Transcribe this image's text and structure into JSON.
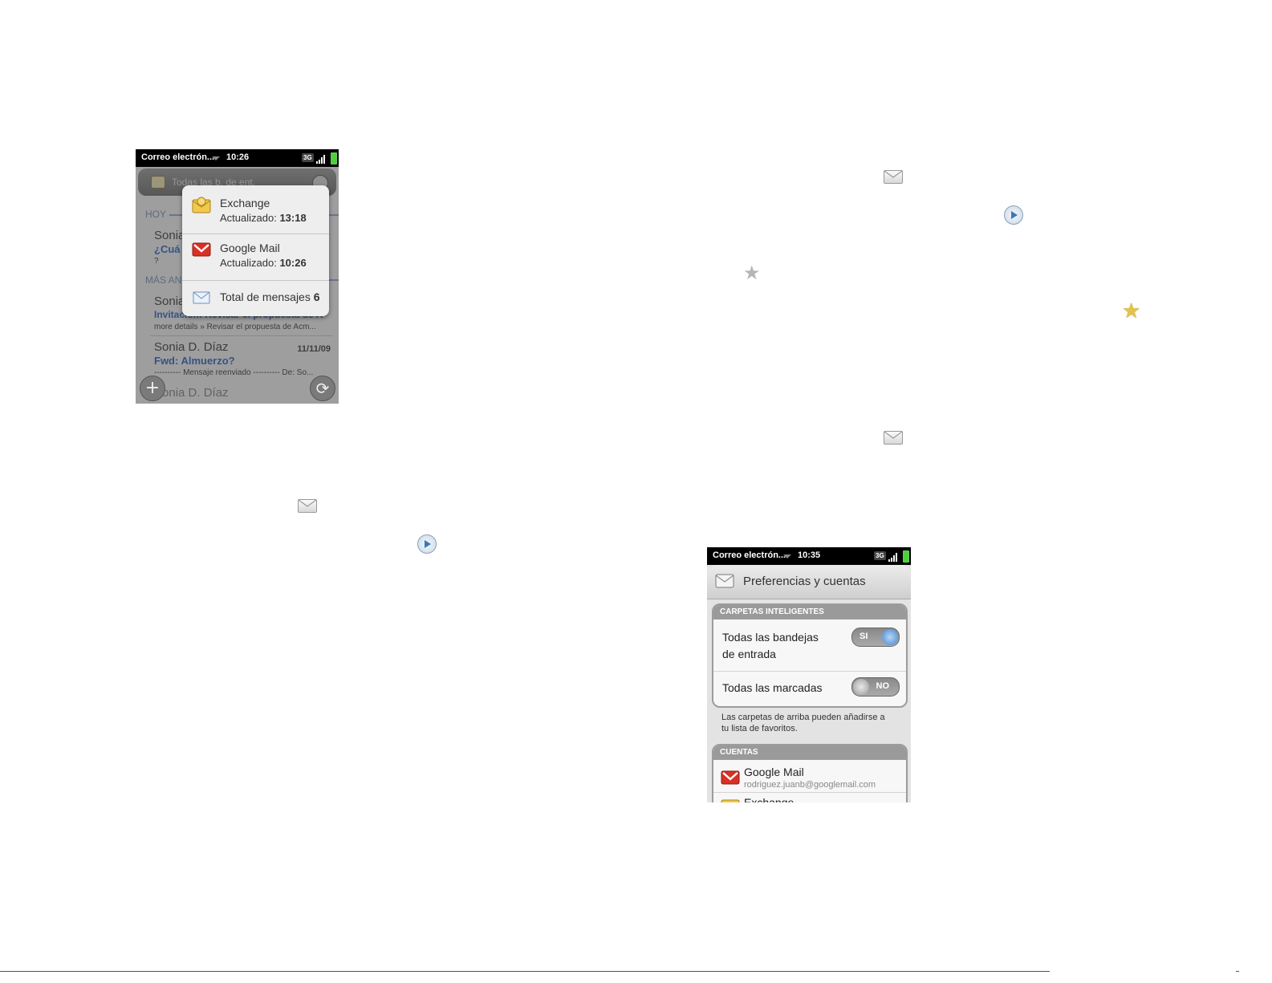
{
  "phone1": {
    "status": {
      "app": "Correo electrón...",
      "time": "10:26",
      "network": "3G"
    },
    "header": {
      "title": "Todas las b. de ent."
    },
    "sections": {
      "today": "HOY",
      "older": "MÁS AN"
    },
    "emails": [
      {
        "from": "Sonia",
        "subject": "¿Cuá",
        "preview": "?"
      },
      {
        "from": "Sonia",
        "subject": "Invitación: Revisar el propuesta de A",
        "preview": "more details » Revisar el propuesta de Acm..."
      },
      {
        "from": "Sonia D. Díaz",
        "date": "11/11/09",
        "subject": "Fwd: Almuerzo?",
        "preview": "---------- Mensaje reenviado ---------- De: So..."
      },
      {
        "from": "Sonia D. Díaz"
      }
    ],
    "popup": {
      "exchange": {
        "name": "Exchange",
        "updated_label": "Actualizado:",
        "updated_time": "13:18"
      },
      "gmail": {
        "name": "Google Mail",
        "updated_label": "Actualizado:",
        "updated_time": "10:26"
      },
      "total": {
        "label": "Total de mensajes",
        "count": "6"
      }
    },
    "buttons": {
      "new": "+",
      "sync": "⟳"
    }
  },
  "phone2": {
    "status": {
      "app": "Correo electrón...",
      "time": "10:35",
      "network": "3G"
    },
    "header": {
      "title": "Preferencias y cuentas"
    },
    "smart_folders": {
      "title": "CARPETAS INTELIGENTES",
      "options": [
        {
          "label_line1": "Todas las bandejas",
          "label_line2": "de entrada",
          "state": "SI"
        },
        {
          "label_line1": "Todas las marcadas",
          "state": "NO"
        }
      ],
      "note_line1": "Las carpetas de arriba pueden añadirse a",
      "note_line2": "tu lista de favoritos."
    },
    "accounts": {
      "title": "CUENTAS",
      "items": [
        {
          "name": "Google Mail",
          "email": "rodriguez.juanb@googlemail.com"
        },
        {
          "name": "Exchange"
        }
      ]
    }
  },
  "icons": {
    "envelope": "envelope-icon",
    "play": "play-icon",
    "star_gray": "star-icon",
    "star_gold": "star-icon",
    "gold": "#e5c34a",
    "accent": "#4a74b8"
  }
}
